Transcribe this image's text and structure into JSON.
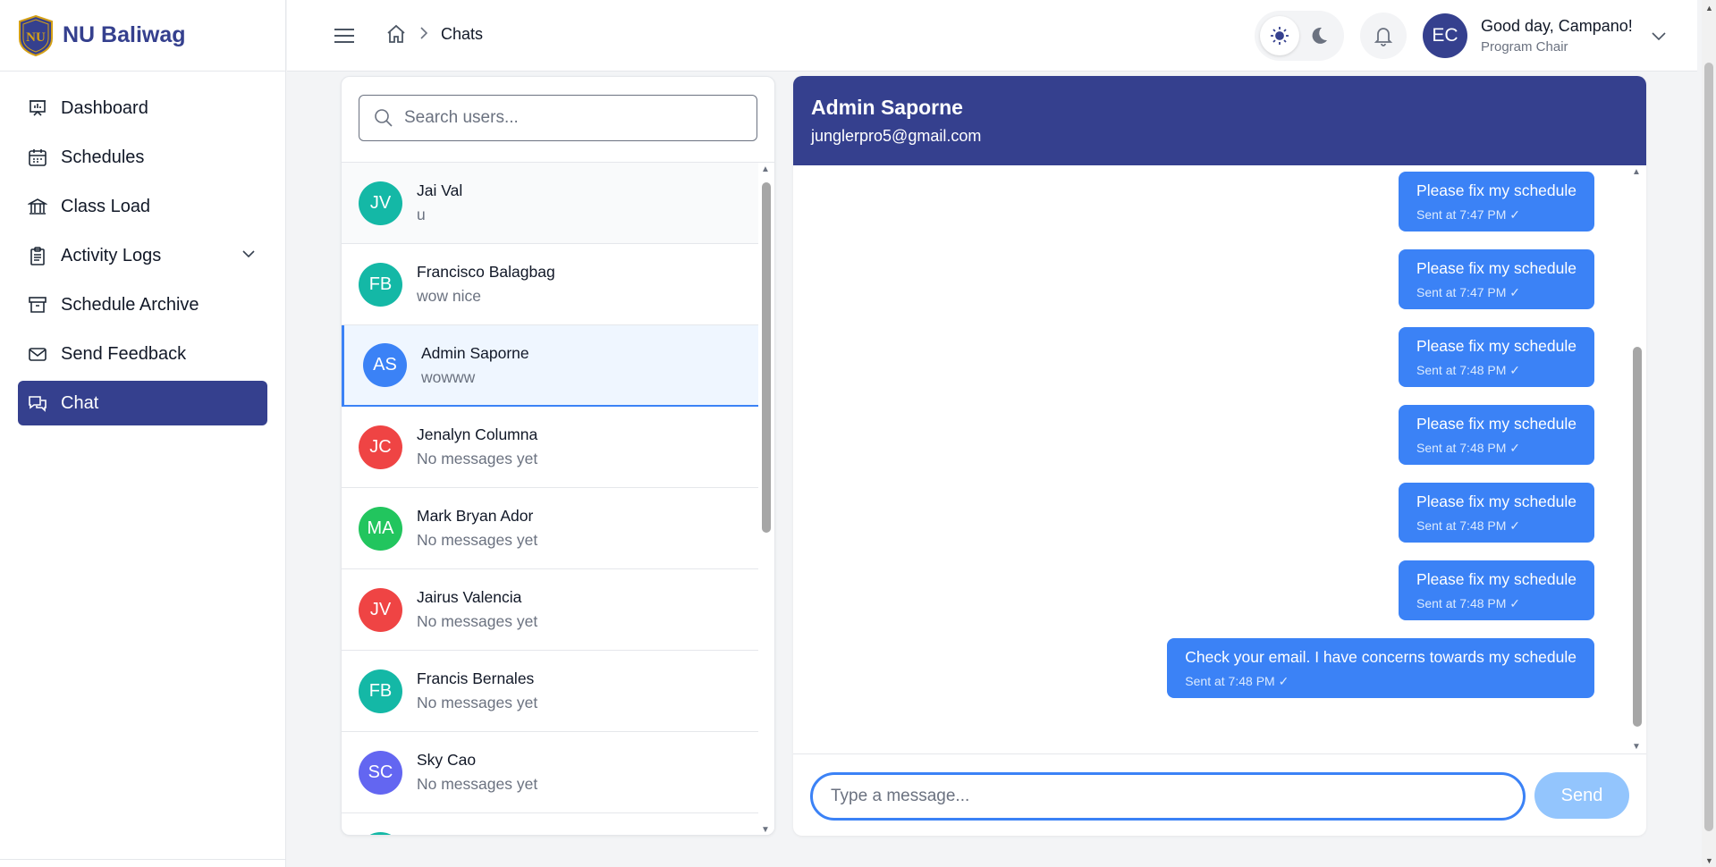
{
  "brand": {
    "name": "NU Baliwag"
  },
  "sidebar": {
    "items": [
      {
        "label": "Dashboard",
        "icon": "dashboard-icon"
      },
      {
        "label": "Schedules",
        "icon": "calendar-icon"
      },
      {
        "label": "Class Load",
        "icon": "building-icon"
      },
      {
        "label": "Activity Logs",
        "icon": "clipboard-icon"
      },
      {
        "label": "Schedule Archive",
        "icon": "archive-icon"
      },
      {
        "label": "Send Feedback",
        "icon": "mail-icon"
      },
      {
        "label": "Chat",
        "icon": "chat-icon"
      }
    ]
  },
  "header": {
    "breadcrumb": "Chats",
    "greeting": "Good day, Campano!",
    "role": "Program Chair",
    "initials": "EC"
  },
  "search": {
    "placeholder": "Search users..."
  },
  "users": [
    {
      "initials": "JV",
      "name": "Jai Val",
      "last": "u",
      "color": "#14b8a6"
    },
    {
      "initials": "FB",
      "name": "Francisco Balagbag",
      "last": "wow nice",
      "color": "#14b8a6"
    },
    {
      "initials": "AS",
      "name": "Admin Saporne",
      "last": "wowww",
      "color": "#3b82f6"
    },
    {
      "initials": "JC",
      "name": "Jenalyn Columna",
      "last": "No messages yet",
      "color": "#ef4444"
    },
    {
      "initials": "MA",
      "name": "Mark Bryan Ador",
      "last": "No messages yet",
      "color": "#22c55e"
    },
    {
      "initials": "JV",
      "name": "Jairus Valencia",
      "last": "No messages yet",
      "color": "#ef4444"
    },
    {
      "initials": "FB",
      "name": "Francis Bernales",
      "last": "No messages yet",
      "color": "#14b8a6"
    },
    {
      "initials": "SC",
      "name": "Sky Cao",
      "last": "No messages yet",
      "color": "#6366f1"
    },
    {
      "initials": "",
      "name": "",
      "last": "",
      "color": "#14b8a6"
    }
  ],
  "chat": {
    "name": "Admin Saporne",
    "email": "junglerpro5@gmail.com",
    "messages": [
      {
        "text": "Please fix my schedule",
        "meta": "Sent at 7:47 PM ✓"
      },
      {
        "text": "Please fix my schedule",
        "meta": "Sent at 7:47 PM ✓"
      },
      {
        "text": "Please fix my schedule",
        "meta": "Sent at 7:48 PM ✓"
      },
      {
        "text": "Please fix my schedule",
        "meta": "Sent at 7:48 PM ✓"
      },
      {
        "text": "Please fix my schedule",
        "meta": "Sent at 7:48 PM ✓"
      },
      {
        "text": "Please fix my schedule",
        "meta": "Sent at 7:48 PM ✓"
      },
      {
        "text": "Check your email. I have concerns towards my schedule",
        "meta": "Sent at 7:48 PM ✓"
      }
    ],
    "input_placeholder": "Type a message...",
    "send_label": "Send"
  }
}
